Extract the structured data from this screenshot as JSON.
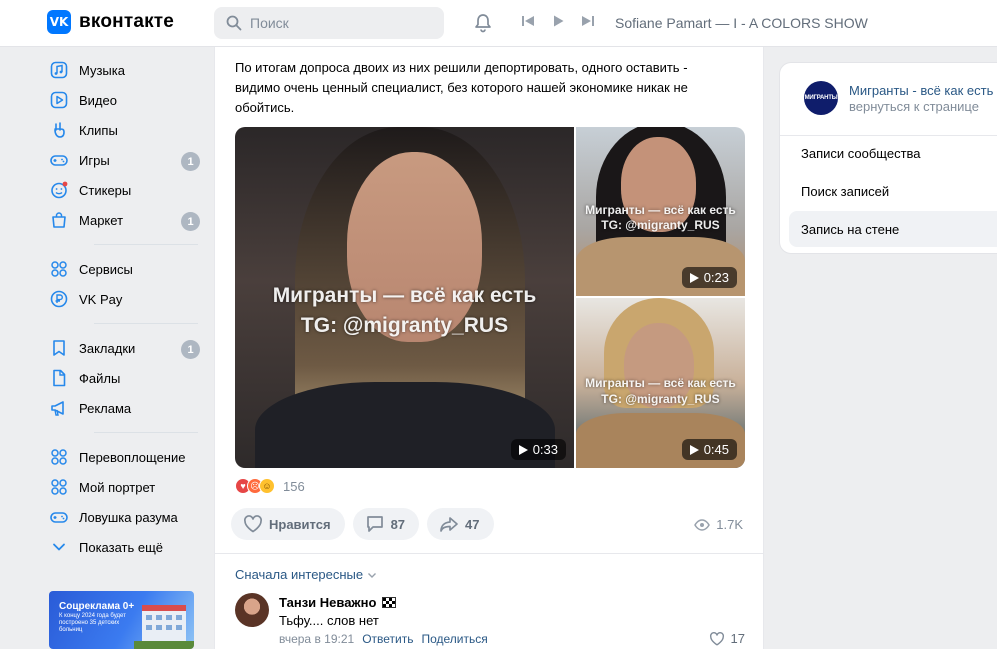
{
  "brand": {
    "logo_mark": "VK",
    "name": "вконтакте",
    "accent": "#0077ff"
  },
  "search": {
    "placeholder": "Поиск"
  },
  "player": {
    "track": "Sofiane Pamart — I - A COLORS SHOW"
  },
  "sidebar": {
    "items": [
      {
        "label": "Музыка",
        "icon": "music-icon"
      },
      {
        "label": "Видео",
        "icon": "video-icon"
      },
      {
        "label": "Клипы",
        "icon": "clips-icon"
      },
      {
        "label": "Игры",
        "icon": "games-icon",
        "badge": "1"
      },
      {
        "label": "Стикеры",
        "icon": "stickers-icon"
      },
      {
        "label": "Маркет",
        "icon": "market-icon",
        "badge": "1"
      },
      {
        "label": "Сервисы",
        "icon": "services-icon"
      },
      {
        "label": "VK Pay",
        "icon": "vkpay-icon"
      },
      {
        "label": "Закладки",
        "icon": "bookmarks-icon",
        "badge": "1"
      },
      {
        "label": "Файлы",
        "icon": "files-icon"
      },
      {
        "label": "Реклама",
        "icon": "ads-icon"
      },
      {
        "label": "Перевоплощение",
        "icon": "app-icon"
      },
      {
        "label": "Мой портрет",
        "icon": "app-icon"
      },
      {
        "label": "Ловушка разума",
        "icon": "gamepad-icon"
      },
      {
        "label": "Показать ещё",
        "icon": "chevron-down-icon"
      }
    ],
    "ad": {
      "title": "Соцреклама 0+",
      "text": "К концу 2024 года будет построено 35 детских больниц"
    }
  },
  "post": {
    "text": "По итогам допроса двоих из них решили депортировать, одного оставить - видимо очень ценный специалист, без которого нашей экономике никак не обойтись.",
    "watermark_line1": "Мигранты — всё как есть",
    "watermark_line2": "TG: @migranty_RUS",
    "videos": [
      {
        "duration": "0:33"
      },
      {
        "duration": "0:23"
      },
      {
        "duration": "0:45"
      }
    ],
    "reactions_count": "156",
    "like_label": "Нравится",
    "comments_count": "87",
    "shares_count": "47",
    "views": "1.7K"
  },
  "comments": {
    "sort_label": "Сначала интересные",
    "items": [
      {
        "author": "Танзи Неважно",
        "text": "Тьфу.... слов нет",
        "time": "вчера в 19:21",
        "reply": "Ответить",
        "share": "Поделиться",
        "likes": "17"
      }
    ]
  },
  "right": {
    "group_avatar_text": "МИГРАНТЫ",
    "group_name": "Мигранты - всё как есть",
    "back_label": "вернуться к странице",
    "menu": [
      "Записи сообщества",
      "Поиск записей",
      "Запись на стене"
    ],
    "active_index": 2
  }
}
